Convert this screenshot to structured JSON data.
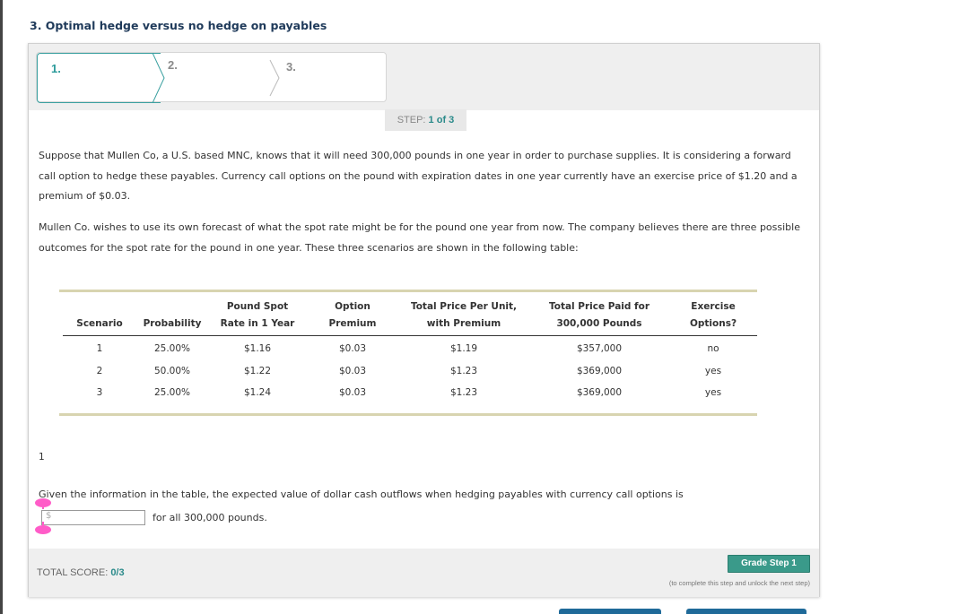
{
  "page": {
    "title": "3. Optimal hedge versus no hedge on payables"
  },
  "stepper": {
    "steps": [
      {
        "label": "1.",
        "state": "active"
      },
      {
        "label": "2.",
        "state": "inactive"
      },
      {
        "label": "3.",
        "state": "inactive"
      }
    ],
    "indicator_prefix": "STEP: ",
    "indicator_current": "1 of 3"
  },
  "content": {
    "paragraph1": "Suppose that Mullen Co, a U.S. based MNC, knows that it will need 300,000 pounds in one year in order to purchase supplies. It is considering a forward call option to hedge these payables. Currency call options on the pound with expiration dates in one year currently have an exercise price of $1.20 and a premium of $0.03.",
    "paragraph2": "Mullen Co. wishes to use its own forecast of what the spot rate might be for the pound one year from now. The company believes there are three possible outcomes for the spot rate for the pound in one year. These three scenarios are shown in the following table:",
    "footnote_number": "1",
    "question": "Given the information in the table, the expected value of dollar cash outflows when hedging payables with currency call options is",
    "answer_prefix": "$",
    "answer_value": "",
    "answer_suffix": "for all 300,000 pounds."
  },
  "table": {
    "headers": [
      {
        "line1": "",
        "line2": "Scenario"
      },
      {
        "line1": "",
        "line2": "Probability"
      },
      {
        "line1": "Pound Spot",
        "line2": "Rate in 1 Year"
      },
      {
        "line1": "Option",
        "line2": "Premium"
      },
      {
        "line1": "Total Price Per Unit,",
        "line2": "with Premium"
      },
      {
        "line1": "Total Price Paid for",
        "line2": "300,000 Pounds"
      },
      {
        "line1": "Exercise",
        "line2": "Options?"
      }
    ],
    "rows": [
      [
        "1",
        "25.00%",
        "$1.16",
        "$0.03",
        "$1.19",
        "$357,000",
        "no"
      ],
      [
        "2",
        "50.00%",
        "$1.22",
        "$0.03",
        "$1.23",
        "$369,000",
        "yes"
      ],
      [
        "3",
        "25.00%",
        "$1.24",
        "$0.03",
        "$1.23",
        "$369,000",
        "yes"
      ]
    ]
  },
  "footer": {
    "total_score_label": "TOTAL SCORE: ",
    "total_score_value": "0/3",
    "grade_button": "Grade Step 1",
    "grade_note": "(to complete this step and unlock the next step)"
  },
  "colors": {
    "accent_teal": "#2a9a9a",
    "title_navy": "#1f3a5a",
    "grade_button": "#3a9a8a",
    "marker_pink": "#ff5cc8",
    "bottom_button_blue": "#1f6a99"
  }
}
